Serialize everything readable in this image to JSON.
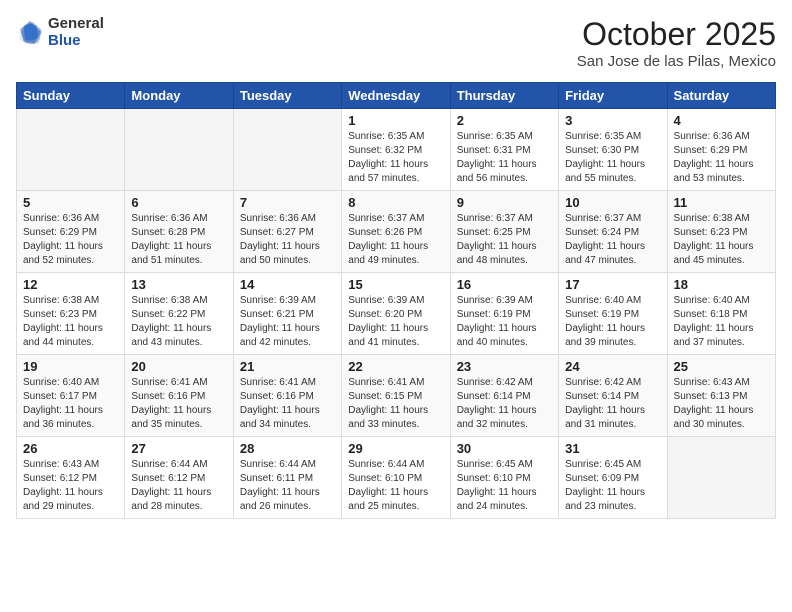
{
  "logo": {
    "general": "General",
    "blue": "Blue"
  },
  "title": "October 2025",
  "location": "San Jose de las Pilas, Mexico",
  "weekdays": [
    "Sunday",
    "Monday",
    "Tuesday",
    "Wednesday",
    "Thursday",
    "Friday",
    "Saturday"
  ],
  "weeks": [
    [
      {
        "day": "",
        "info": ""
      },
      {
        "day": "",
        "info": ""
      },
      {
        "day": "",
        "info": ""
      },
      {
        "day": "1",
        "info": "Sunrise: 6:35 AM\nSunset: 6:32 PM\nDaylight: 11 hours\nand 57 minutes."
      },
      {
        "day": "2",
        "info": "Sunrise: 6:35 AM\nSunset: 6:31 PM\nDaylight: 11 hours\nand 56 minutes."
      },
      {
        "day": "3",
        "info": "Sunrise: 6:35 AM\nSunset: 6:30 PM\nDaylight: 11 hours\nand 55 minutes."
      },
      {
        "day": "4",
        "info": "Sunrise: 6:36 AM\nSunset: 6:29 PM\nDaylight: 11 hours\nand 53 minutes."
      }
    ],
    [
      {
        "day": "5",
        "info": "Sunrise: 6:36 AM\nSunset: 6:29 PM\nDaylight: 11 hours\nand 52 minutes."
      },
      {
        "day": "6",
        "info": "Sunrise: 6:36 AM\nSunset: 6:28 PM\nDaylight: 11 hours\nand 51 minutes."
      },
      {
        "day": "7",
        "info": "Sunrise: 6:36 AM\nSunset: 6:27 PM\nDaylight: 11 hours\nand 50 minutes."
      },
      {
        "day": "8",
        "info": "Sunrise: 6:37 AM\nSunset: 6:26 PM\nDaylight: 11 hours\nand 49 minutes."
      },
      {
        "day": "9",
        "info": "Sunrise: 6:37 AM\nSunset: 6:25 PM\nDaylight: 11 hours\nand 48 minutes."
      },
      {
        "day": "10",
        "info": "Sunrise: 6:37 AM\nSunset: 6:24 PM\nDaylight: 11 hours\nand 47 minutes."
      },
      {
        "day": "11",
        "info": "Sunrise: 6:38 AM\nSunset: 6:23 PM\nDaylight: 11 hours\nand 45 minutes."
      }
    ],
    [
      {
        "day": "12",
        "info": "Sunrise: 6:38 AM\nSunset: 6:23 PM\nDaylight: 11 hours\nand 44 minutes."
      },
      {
        "day": "13",
        "info": "Sunrise: 6:38 AM\nSunset: 6:22 PM\nDaylight: 11 hours\nand 43 minutes."
      },
      {
        "day": "14",
        "info": "Sunrise: 6:39 AM\nSunset: 6:21 PM\nDaylight: 11 hours\nand 42 minutes."
      },
      {
        "day": "15",
        "info": "Sunrise: 6:39 AM\nSunset: 6:20 PM\nDaylight: 11 hours\nand 41 minutes."
      },
      {
        "day": "16",
        "info": "Sunrise: 6:39 AM\nSunset: 6:19 PM\nDaylight: 11 hours\nand 40 minutes."
      },
      {
        "day": "17",
        "info": "Sunrise: 6:40 AM\nSunset: 6:19 PM\nDaylight: 11 hours\nand 39 minutes."
      },
      {
        "day": "18",
        "info": "Sunrise: 6:40 AM\nSunset: 6:18 PM\nDaylight: 11 hours\nand 37 minutes."
      }
    ],
    [
      {
        "day": "19",
        "info": "Sunrise: 6:40 AM\nSunset: 6:17 PM\nDaylight: 11 hours\nand 36 minutes."
      },
      {
        "day": "20",
        "info": "Sunrise: 6:41 AM\nSunset: 6:16 PM\nDaylight: 11 hours\nand 35 minutes."
      },
      {
        "day": "21",
        "info": "Sunrise: 6:41 AM\nSunset: 6:16 PM\nDaylight: 11 hours\nand 34 minutes."
      },
      {
        "day": "22",
        "info": "Sunrise: 6:41 AM\nSunset: 6:15 PM\nDaylight: 11 hours\nand 33 minutes."
      },
      {
        "day": "23",
        "info": "Sunrise: 6:42 AM\nSunset: 6:14 PM\nDaylight: 11 hours\nand 32 minutes."
      },
      {
        "day": "24",
        "info": "Sunrise: 6:42 AM\nSunset: 6:14 PM\nDaylight: 11 hours\nand 31 minutes."
      },
      {
        "day": "25",
        "info": "Sunrise: 6:43 AM\nSunset: 6:13 PM\nDaylight: 11 hours\nand 30 minutes."
      }
    ],
    [
      {
        "day": "26",
        "info": "Sunrise: 6:43 AM\nSunset: 6:12 PM\nDaylight: 11 hours\nand 29 minutes."
      },
      {
        "day": "27",
        "info": "Sunrise: 6:44 AM\nSunset: 6:12 PM\nDaylight: 11 hours\nand 28 minutes."
      },
      {
        "day": "28",
        "info": "Sunrise: 6:44 AM\nSunset: 6:11 PM\nDaylight: 11 hours\nand 26 minutes."
      },
      {
        "day": "29",
        "info": "Sunrise: 6:44 AM\nSunset: 6:10 PM\nDaylight: 11 hours\nand 25 minutes."
      },
      {
        "day": "30",
        "info": "Sunrise: 6:45 AM\nSunset: 6:10 PM\nDaylight: 11 hours\nand 24 minutes."
      },
      {
        "day": "31",
        "info": "Sunrise: 6:45 AM\nSunset: 6:09 PM\nDaylight: 11 hours\nand 23 minutes."
      },
      {
        "day": "",
        "info": ""
      }
    ]
  ]
}
